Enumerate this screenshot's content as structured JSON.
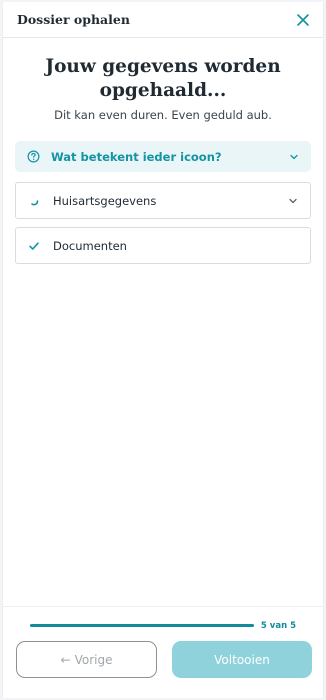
{
  "header": {
    "title": "Dossier ophalen",
    "close_icon": "close-icon"
  },
  "main": {
    "title": "Jouw gegevens worden opgehaald...",
    "subtitle": "Dit kan even duren. Even geduld aub."
  },
  "info": {
    "label": "Wat betekent ieder icoon?",
    "icon": "question-circle-icon"
  },
  "items": [
    {
      "label": "Huisartsgegevens",
      "status": "loading",
      "icon": "spinner-icon"
    },
    {
      "label": "Documenten",
      "status": "done",
      "icon": "check-icon"
    }
  ],
  "footer": {
    "progress_label": "5 van 5",
    "progress": 1.0,
    "prev_label": "Vorige",
    "finish_label": "Voltooien"
  },
  "colors": {
    "accent": "#138b9c",
    "info_bg": "#e9f5f6",
    "finish_disabled": "#8fd2dc"
  }
}
